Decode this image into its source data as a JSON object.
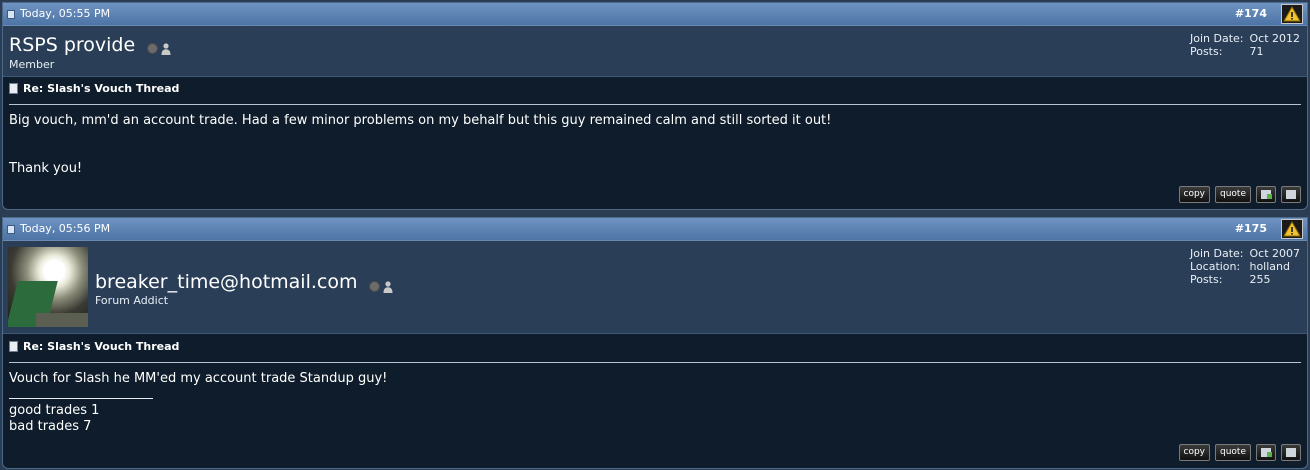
{
  "posts": [
    {
      "date": "Today, 05:55 PM",
      "number": "#174",
      "username": "RSPS provide",
      "user_title": "Member",
      "stats": [
        {
          "label": "Join Date:",
          "value": "Oct 2012"
        },
        {
          "label": "Posts:",
          "value": "71"
        }
      ],
      "post_title": "Re: Slash's Vouch Thread",
      "message": "Big vouch, mm'd an account trade. Had a few minor problems on my behalf but this guy remained calm and still sorted it out!\n\n\nThank you!",
      "signature": "",
      "buttons": {
        "copy": "copy",
        "quote": "quote"
      }
    },
    {
      "date": "Today, 05:56 PM",
      "number": "#175",
      "username": "breaker_time@hotmail.com",
      "user_title": "Forum Addict",
      "stats": [
        {
          "label": "Join Date:",
          "value": "Oct 2007"
        },
        {
          "label": "Location:",
          "value": "holland"
        },
        {
          "label": "Posts:",
          "value": "255"
        }
      ],
      "post_title": "Re: Slash's Vouch Thread",
      "message": "Vouch for Slash he MM'ed my account trade Standup guy!",
      "signature": "good trades 1\nbad trades 7",
      "buttons": {
        "copy": "copy",
        "quote": "quote"
      }
    }
  ],
  "icons": {
    "post_icon": "document-icon",
    "report": "warning-icon",
    "status": "offline-status-icon",
    "profile": "person-icon",
    "multiquote": "add-to-list-icon",
    "edit": "edit-icon"
  }
}
